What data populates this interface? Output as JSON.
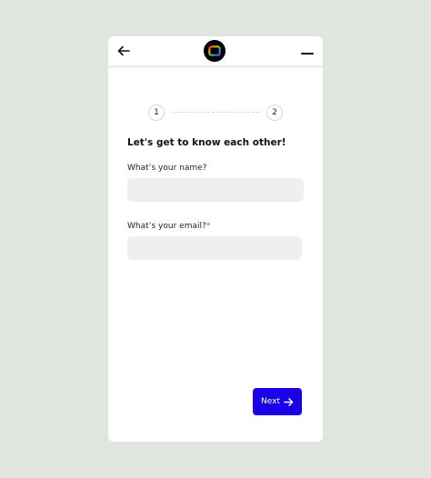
{
  "header": {
    "back_icon": "arrow-left-icon",
    "logo_icon": "app-logo",
    "menu_icon": "menu-icon"
  },
  "stepper": {
    "steps": [
      "1",
      "2"
    ],
    "current": 1
  },
  "form": {
    "heading": "Let's get to know each other!",
    "name_label": "What’s your name?",
    "name_value": "",
    "email_label": "What’s your email?",
    "email_required_mark": "*",
    "email_value": ""
  },
  "actions": {
    "next_label": "Next",
    "next_icon": "arrow-right-icon"
  },
  "colors": {
    "background": "#e0e5de",
    "card": "#ffffff",
    "primary": "#1a00e8",
    "required": "#e0453a",
    "input_bg": "#efefef"
  }
}
